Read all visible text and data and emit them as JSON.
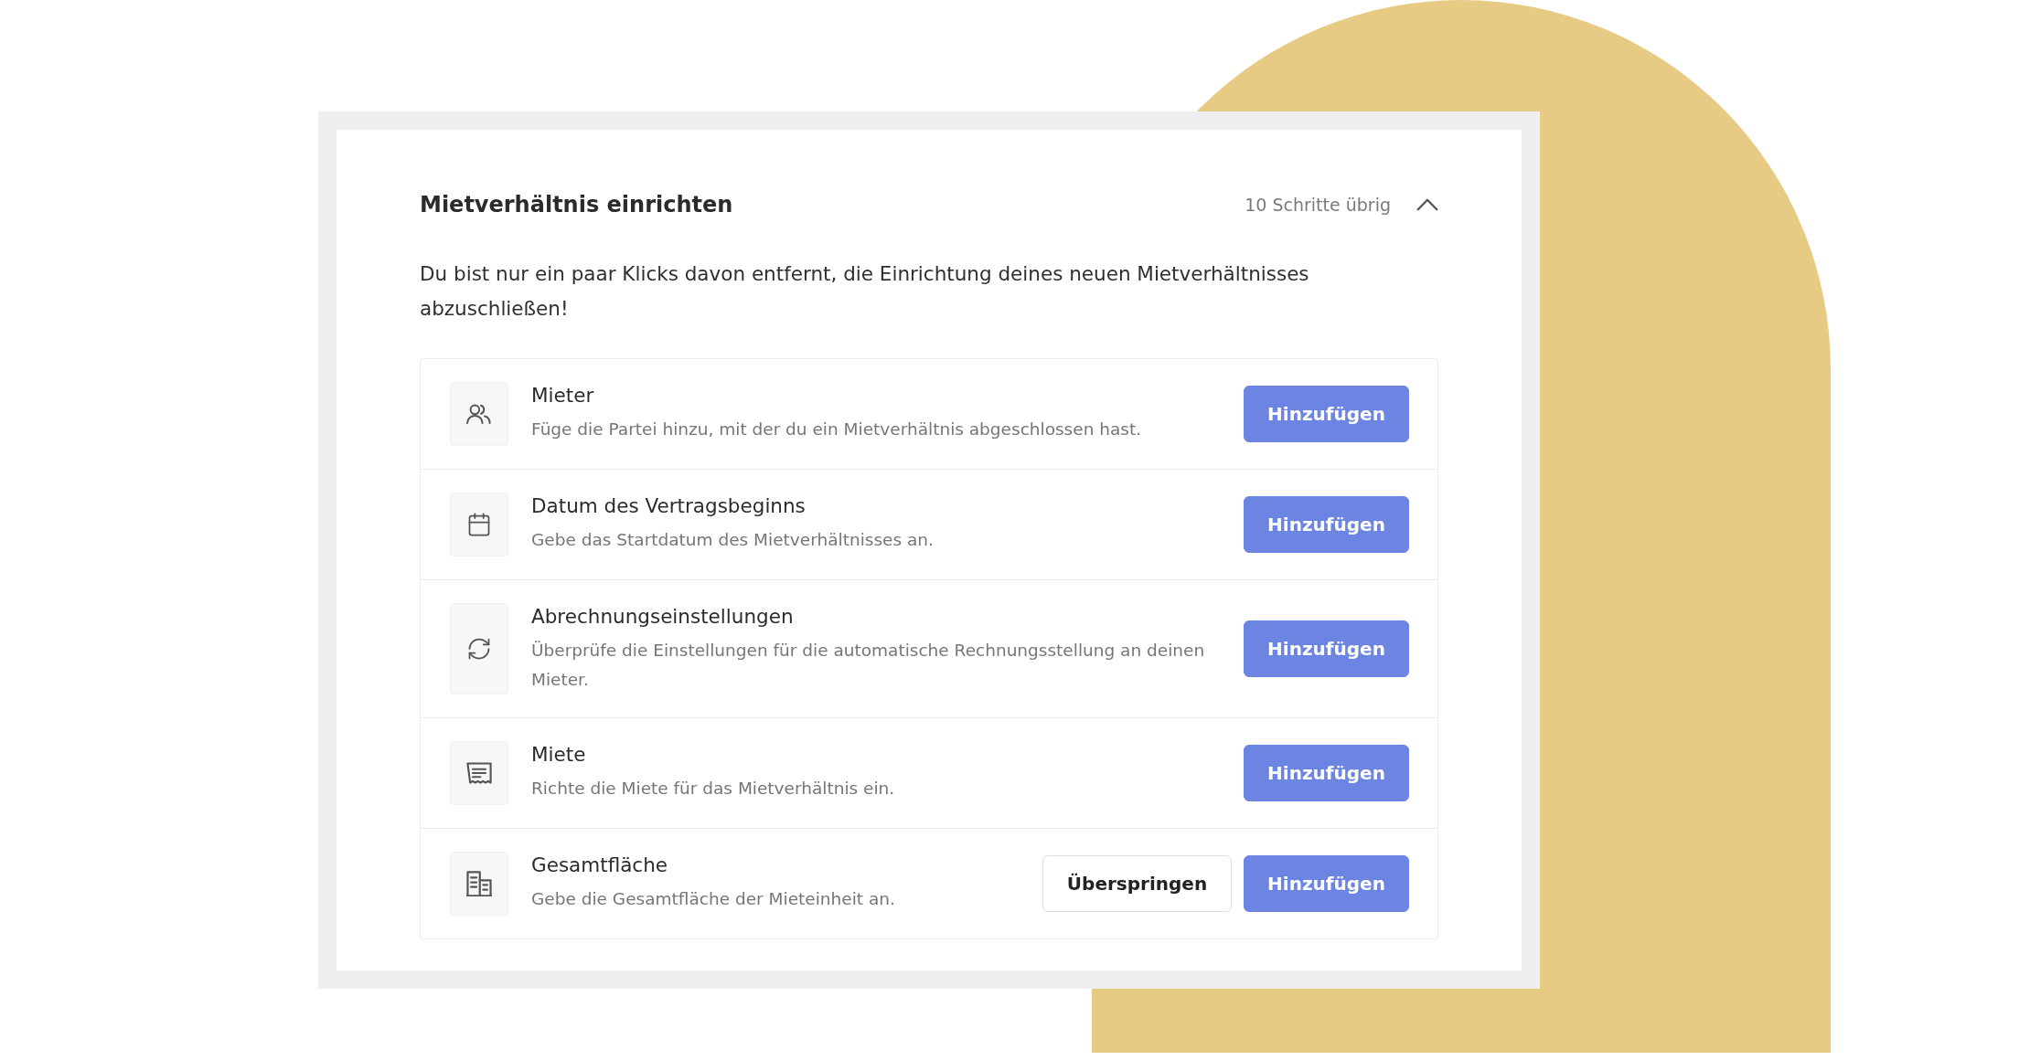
{
  "card": {
    "title": "Mietverhältnis einrichten",
    "steps_remaining": "10 Schritte übrig",
    "expanded": true,
    "description": "Du bist nur ein paar Klicks davon entfernt, die Einrichtung deines neuen Mietverhältnisses abzuschließen!",
    "steps": [
      {
        "title": "Mieter",
        "description": "Füge die Partei hinzu, mit der du ein Mietverhältnis abgeschlossen hast.",
        "buttons": [
          {
            "label": "Hinzufügen",
            "kind": "primary"
          }
        ]
      },
      {
        "title": "Datum des Vertragsbeginns",
        "description": "Gebe das Startdatum des Mietverhältnisses an.",
        "buttons": [
          {
            "label": "Hinzufügen",
            "kind": "primary"
          }
        ]
      },
      {
        "title": "Abrechnungseinstellungen",
        "description": "Überprüfe die Einstellungen für die automatische Rechnungsstellung an deinen Mieter.",
        "buttons": [
          {
            "label": "Hinzufügen",
            "kind": "primary"
          }
        ]
      },
      {
        "title": "Miete",
        "description": "Richte die Miete für das Mietverhältnis ein.",
        "buttons": [
          {
            "label": "Hinzufügen",
            "kind": "primary"
          }
        ]
      },
      {
        "title": "Gesamtfläche",
        "description": "Gebe die Gesamtfläche der Mieteinheit an.",
        "buttons": [
          {
            "label": "Überspringen",
            "kind": "secondary"
          },
          {
            "label": "Hinzufügen",
            "kind": "primary"
          }
        ]
      }
    ]
  }
}
